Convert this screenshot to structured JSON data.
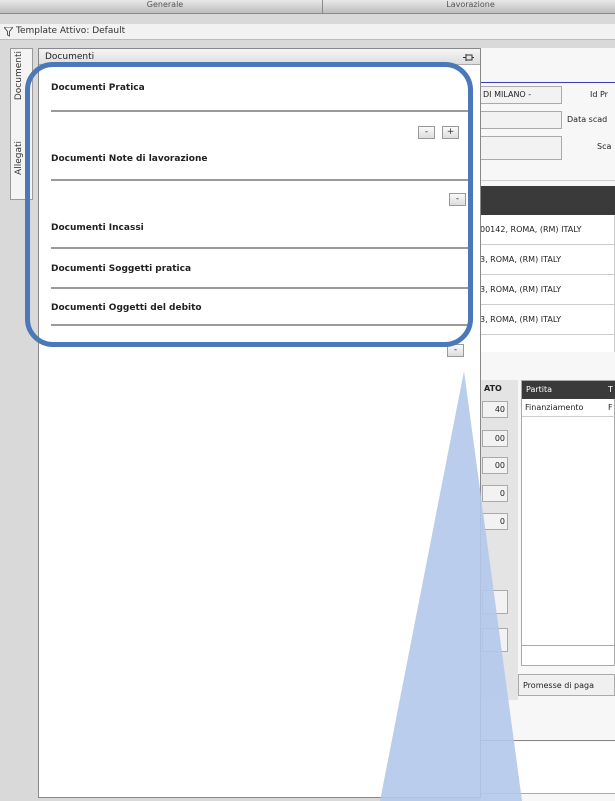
{
  "top_tabs": [
    "Generale",
    "Lavorazione"
  ],
  "template_bar": {
    "label": "Template Attivo: Default"
  },
  "side_tabs": [
    "Documenti",
    "Allegati"
  ],
  "documents_panel": {
    "title": "Documenti",
    "pin_icon": "pin-icon",
    "sections": [
      "Documenti Pratica",
      "Documenti Note di lavorazione",
      "Documenti Incassi",
      "Documenti Soggetti pratica",
      "Documenti Oggetti del debito"
    ],
    "buttons": {
      "minus": "-",
      "plus": "+"
    }
  },
  "background_form": {
    "creditor": "DI MILANO -",
    "id_label": "Id Pr",
    "due_date_label": "Data scad",
    "sca_label": "Sca"
  },
  "address_rows": [
    "00142, ROMA, (RM) ITALY",
    "3, ROMA, (RM) ITALY",
    "3, ROMA, (RM) ITALY",
    "3, ROMA, (RM) ITALY"
  ],
  "amount_column": {
    "header": "ATO",
    "values": [
      "40",
      "00",
      "00",
      "0",
      "0"
    ]
  },
  "partita_table": {
    "headers": [
      "Partita",
      "T"
    ],
    "rows": [
      [
        "Finanziamento",
        "F"
      ]
    ]
  },
  "bottom_tab": "Promesse di paga",
  "colors": {
    "accent": "#4a78b8",
    "callout": "#b3c8ea"
  }
}
